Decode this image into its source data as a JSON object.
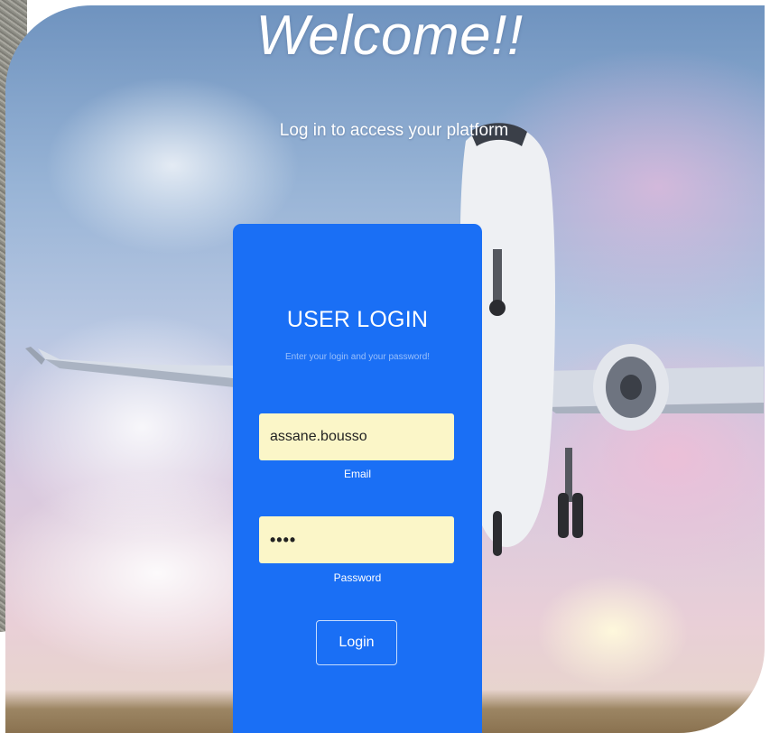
{
  "page": {
    "welcome_title": "Welcome!!",
    "subtitle": "Log in to access your platform"
  },
  "login": {
    "title": "USER LOGIN",
    "hint": "Enter your login and your password!",
    "email": {
      "value": "assane.bousso",
      "label": "Email"
    },
    "password": {
      "value": "••••",
      "label": "Password"
    },
    "submit_label": "Login"
  },
  "colors": {
    "card_background": "#1a6ff5",
    "input_background": "#fbf6c8",
    "text_on_card": "#ffffff"
  },
  "background": {
    "image_icon": "airplane-takeoff-sky-photo"
  }
}
